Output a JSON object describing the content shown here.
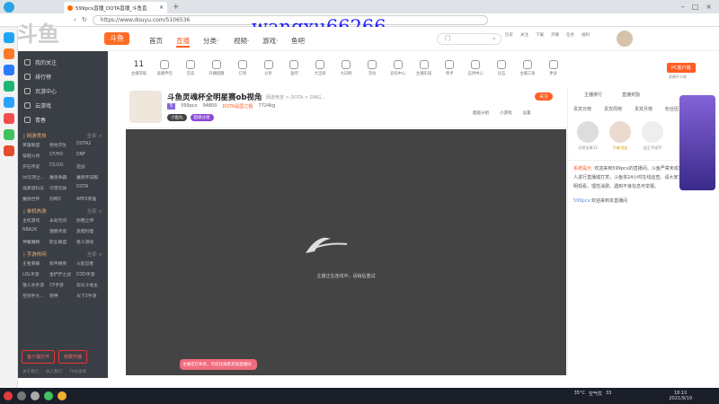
{
  "browser": {
    "tab_title": "599pcx直播_DOTA直播_斗鱼直",
    "new_tab": "+",
    "url": "https://www.douyu.com/5106536"
  },
  "watermark": "wangxu66266",
  "header": {
    "logo": "斗鱼",
    "nav": [
      "首页",
      "直播",
      "分类·",
      "视频·",
      "游戏·",
      "鱼吧"
    ],
    "search_placeholder": "门",
    "icons": [
      "历史",
      "关注",
      "下载",
      "开播",
      "任务",
      "福利"
    ]
  },
  "sidebar": {
    "nav": [
      "我的关注",
      "排行榜",
      "页游中心",
      "云游戏"
    ],
    "fav": "青春",
    "sections": [
      {
        "title": "| 网游竞技",
        "more": "全部 >",
        "items": [
          "英雄联盟",
          "绝地求生",
          "DOTA2",
          "穿越火线",
          "CF/HD",
          "DNF",
          "炉石传说",
          "CS:GO",
          "逆战",
          "lol云顶之...",
          "魔兽争霸",
          "魔兽怀旧服",
          "逃离塔科夫",
          "守望先锋",
          "DOTA",
          "魔兽世界",
          "剑网3",
          "APEX英雄"
        ]
      },
      {
        "title": "| 单机热游",
        "more": "全部 >",
        "items": [
          "主机游戏",
          "永劫无间",
          "防晒之师",
          "NBA2K",
          "饿狼传说",
          "黑暗料理",
          "神魔魔精",
          "职业联盟",
          "格斗游戏"
        ]
      },
      {
        "title": "| 手游休闲",
        "more": "全部 >",
        "items": [
          "王者荣耀",
          "和平精英",
          "火影忍者",
          "LOL手游",
          "金铲铲之战",
          "COD手游",
          "狼人杀手游",
          "CF手游",
          "欢乐斗地主",
          "空闲手大...",
          "原神",
          "天下3手游"
        ]
      }
    ],
    "buttons": [
      "客户端打开",
      "我要开播"
    ],
    "footer": [
      "关于我们",
      "加入我们",
      "TS号查询"
    ]
  },
  "room": {
    "level_badge": "11",
    "level_label": "主播等级",
    "stats": [
      "直播伴侣",
      "首充",
      "开播提醒",
      "订阅",
      "分享",
      "鱼吧",
      "大当家",
      "大日刷",
      "活动",
      "竞技中心",
      "主播乐园",
      "牵手",
      "应用中心",
      "钻石",
      "主播工具",
      "更多"
    ],
    "pc_button": "PC客户端",
    "pc_sub": "直播不卡顿",
    "title": "斗鱼灵魂杯全明星赛ob视角",
    "report": "举报",
    "report2": "网游竞技 > DOTA > DWG...",
    "anchor": "599pcx",
    "hot": "94800",
    "tag": "DOTA是国之粗",
    "fans": "7724kg",
    "vote_badge": "小鱼丸",
    "follow": "关注",
    "fav_count": "5",
    "loading_text": "主播正在连线中，请稍后重试",
    "toast": "主播还在休息，可前往观看其他直播间",
    "hover_icons": [
      "超级分组",
      "小游戏",
      "设置"
    ]
  },
  "right": {
    "tabs": [
      "贵宾日榜",
      "贵宾周榜",
      "贵宾月榜",
      "粉丝团"
    ],
    "rank_title": "主播排行",
    "rank_title2": "直播奖励",
    "fans": [
      "天然金黄12",
      "为难浅笑",
      "战王不成不"
    ],
    "chat_label": "系统提示:",
    "chat_text": "欢迎来到599pcx的直播间。斗鱼严禁未成年人进行直播或打赏，斗鱼将24小时在线巡查。请大家文明观看，理性消费。遇到不良信息可举报。",
    "chat_user": "599pcx",
    "chat_user_msg": "欢迎来到本直播间"
  },
  "taskbar": {
    "temp": "35°C",
    "air": "空气优",
    "aqi": "33",
    "time": "18:10",
    "date": "2021/9/19"
  },
  "colors": {
    "accent": "#ff5d23",
    "sidebar_bg": "#3a3f45",
    "player_bg": "#444444"
  }
}
